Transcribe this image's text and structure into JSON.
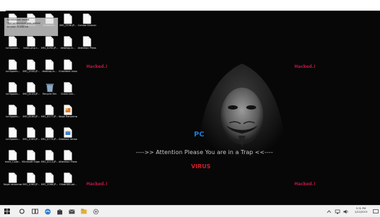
{
  "notification": {
    "line1": "Screenshot saved",
    "line2": "The screenshot was added",
    "line3": "to your OneDrive."
  },
  "desktop_icons": [
    {
      "label": "Screensh...",
      "icon": "image-file-icon"
    },
    {
      "label": "Screensh...",
      "icon": "document-file-icon"
    },
    {
      "label": "Screensh...",
      "icon": "document-file-icon"
    },
    {
      "label": "IMG_2536.JP...",
      "icon": "document-file-icon"
    },
    {
      "label": "Combo Cleaner.lnk",
      "icon": "document-file-icon"
    },
    {
      "label": "runSpawn...",
      "icon": "document-file-icon"
    },
    {
      "label": "Index.php.r...",
      "icon": "document-file-icon"
    },
    {
      "label": "IMG_4292.JP...",
      "icon": "document-file-icon"
    },
    {
      "label": "desktop.in...",
      "icon": "document-file-icon"
    },
    {
      "label": "Attention Please",
      "icon": "document-file-icon"
    },
    {
      "label": "runSpawn...",
      "icon": "document-file-icon"
    },
    {
      "label": "IMG_2500.JP...",
      "icon": "document-file-icon"
    },
    {
      "label": "desktop.in...",
      "icon": "document-file-icon"
    },
    {
      "label": "Crashtest ransomware",
      "icon": "document-file-icon"
    },
    {
      "label": "runSpawn...",
      "icon": "document-file-icon"
    },
    {
      "label": "IMG_6103.JP...",
      "icon": "document-file-icon"
    },
    {
      "label": "Recycle Bin",
      "icon": "recycle-bin-icon"
    },
    {
      "label": "Check.bat...",
      "icon": "document-file-icon"
    },
    {
      "label": "runSpawn...",
      "icon": "document-file-icon"
    },
    {
      "label": "IMG_6184.JP...",
      "icon": "document-file-icon"
    },
    {
      "label": "IMG_4177.JP...",
      "icon": "document-file-icon"
    },
    {
      "label": "Nope Ransomware",
      "icon": "colored-file-icon"
    },
    {
      "label": "runSpawn...",
      "icon": "document-file-icon"
    },
    {
      "label": "IMG_1063.JP...",
      "icon": "document-file-icon"
    },
    {
      "label": "IMG_4775.JP...",
      "icon": "document-file-icon"
    },
    {
      "label": "Dataloss ransomware",
      "icon": "program-icon"
    },
    {
      "label": "more_Code...",
      "icon": "document-file-icon"
    },
    {
      "label": "Microsoft Edge.lnk.r...",
      "icon": "document-file-icon"
    },
    {
      "label": "IMG_4113.JP...",
      "icon": "document-file-icon"
    },
    {
      "label": "Attention Please",
      "icon": "document-file-icon"
    },
    {
      "label": "Nope ransomware",
      "icon": "document-file-icon"
    },
    {
      "label": "IMG_1065.JP...",
      "icon": "document-file-icon"
    },
    {
      "label": "IMG_1066.JP...",
      "icon": "document-file-icon"
    },
    {
      "label": "1f4ab380.pd...",
      "icon": "document-file-icon"
    }
  ],
  "wallpaper": {
    "hacked_label": "Hacked.!",
    "pc_label": "PC",
    "attention_label": "---->> Attention Please You are in a Trap <<----",
    "virus_label": "VIRUS",
    "accent_red": "#cc1f2a",
    "accent_blue": "#1a7bd6"
  },
  "taskbar": {
    "items": [
      "windows-start-icon",
      "cortana-search-icon",
      "task-view-icon",
      "edge-browser-icon",
      "store-icon",
      "mail-icon",
      "file-explorer-icon",
      "media-icon",
      "settings-icon"
    ],
    "time": "3:31 PM",
    "date": "1/22/2019"
  }
}
